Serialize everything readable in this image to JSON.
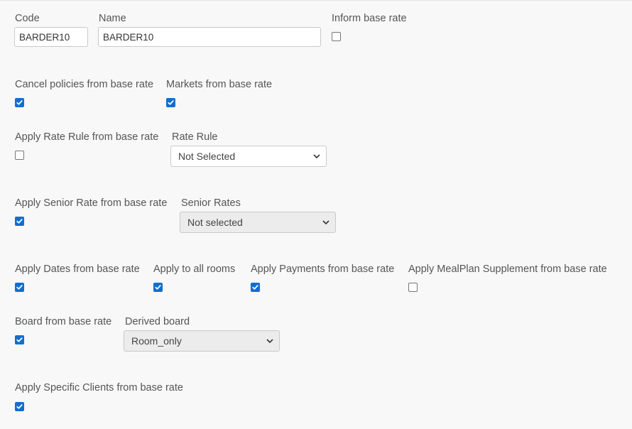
{
  "general": {
    "code_label": "Code",
    "code_value": "BARDER10",
    "name_label": "Name",
    "name_value": "BARDER10",
    "inform_base_rate_label": "Inform base rate",
    "inform_base_rate_checked": false
  },
  "policies": {
    "cancel_label": "Cancel policies from base rate",
    "cancel_checked": true,
    "markets_label": "Markets from base rate",
    "markets_checked": true
  },
  "rate_rule": {
    "apply_label": "Apply Rate Rule from base rate",
    "apply_checked": false,
    "select_label": "Rate Rule",
    "select_value": "Not Selected"
  },
  "senior": {
    "apply_label": "Apply Senior Rate from base rate",
    "apply_checked": true,
    "select_label": "Senior Rates",
    "select_value": "Not selected"
  },
  "options": {
    "dates_label": "Apply Dates from base rate",
    "dates_checked": true,
    "rooms_label": "Apply to all rooms",
    "rooms_checked": true,
    "payments_label": "Apply Payments from base rate",
    "payments_checked": true,
    "mealplan_label": "Apply MealPlan Supplement from base rate",
    "mealplan_checked": false
  },
  "board": {
    "from_base_label": "Board from base rate",
    "from_base_checked": true,
    "derived_label": "Derived board",
    "derived_value": "Room_only"
  },
  "clients": {
    "apply_label": "Apply Specific Clients from base rate",
    "apply_checked": true
  },
  "colors": {
    "checkbox_accent": "#0f6fcf",
    "label_text": "#555555",
    "page_background": "#f8f8f8"
  }
}
